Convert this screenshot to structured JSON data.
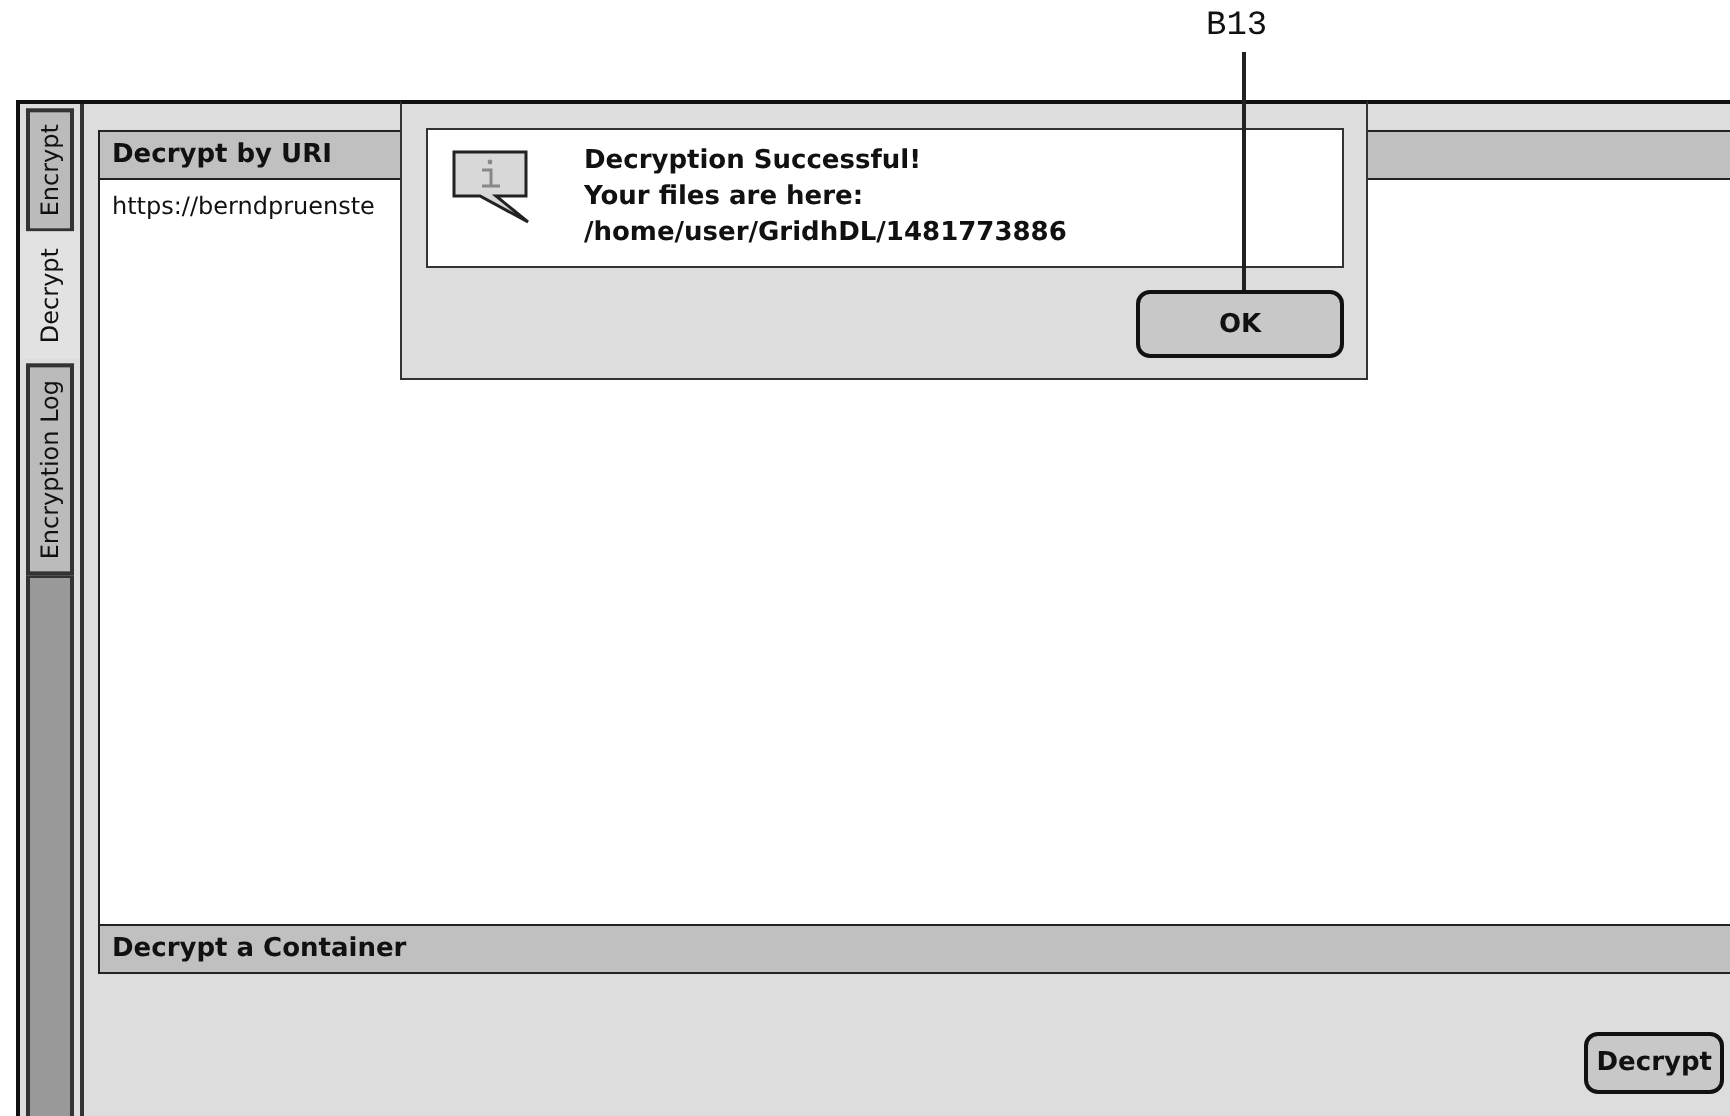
{
  "annotation": {
    "label": "B13"
  },
  "tabs": [
    {
      "label": "Encrypt",
      "selected": false
    },
    {
      "label": "Decrypt",
      "selected": true
    },
    {
      "label": "Encryption Log",
      "selected": false
    }
  ],
  "uri_section": {
    "title": "Decrypt by URI",
    "value": "https://berndpruenste"
  },
  "container_section": {
    "title": "Decrypt a Container"
  },
  "decrypt_button": {
    "label": "Decrypt"
  },
  "dialog": {
    "lines": [
      "Decryption Successful!",
      "Your files are here:",
      "/home/user/GridhDL/1481773886"
    ],
    "ok_button": "OK"
  }
}
